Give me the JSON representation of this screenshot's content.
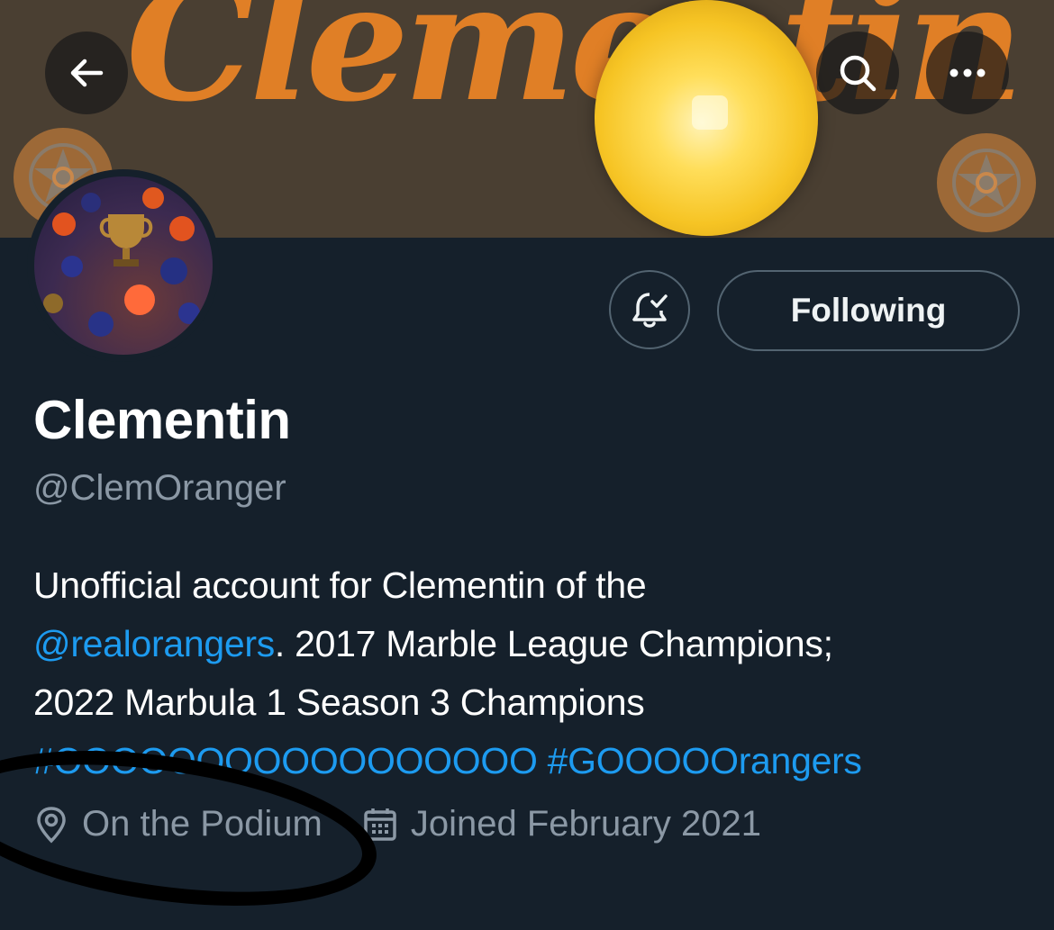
{
  "banner": {
    "script_text": "Clementin"
  },
  "header": {
    "back_icon": "arrow-left-icon",
    "search_icon": "search-icon",
    "more_icon": "more-horizontal-icon"
  },
  "actions": {
    "notification_icon": "bell-check-icon",
    "following_label": "Following"
  },
  "profile": {
    "display_name": "Clementin",
    "handle": "@ClemOranger",
    "bio": {
      "line1": "Unofficial account for Clementin of the",
      "mention": "@realorangers",
      "line2_rest": ". 2017 Marble League Champions;",
      "line3": "2022 Marbula 1 Season 3 Champions",
      "hashtag1": "#OOOOOOOOOOOOOOOOO",
      "hashtag2": "#GOOOOOrangers"
    },
    "location": "On the Podium",
    "joined": "Joined February 2021"
  },
  "colors": {
    "background": "#15202b",
    "link": "#1d9bf0",
    "secondary_text": "#8b98a5",
    "banner_text": "#e07f26"
  }
}
